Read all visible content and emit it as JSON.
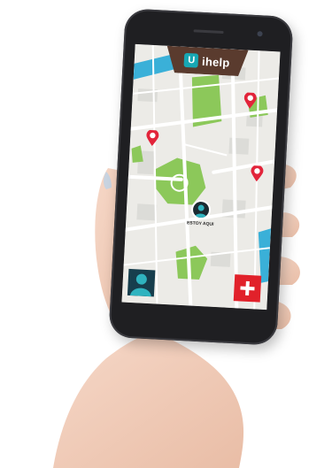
{
  "app": {
    "name": "ihelp",
    "logo_letter": "U"
  },
  "map": {
    "user_marker_label": "ESTOY AQUI"
  },
  "colors": {
    "brand_bar": "#5a3b2e",
    "accent_teal": "#17a7b3",
    "pin_red": "#e2243a",
    "park_green": "#8cc85a",
    "water_blue": "#3ab0d8",
    "emergency_red": "#e1212a",
    "profile_navy": "#173e4d"
  },
  "icons": {
    "location_pin": "location-pin-icon",
    "user": "user-avatar-icon",
    "plus": "plus-icon"
  }
}
